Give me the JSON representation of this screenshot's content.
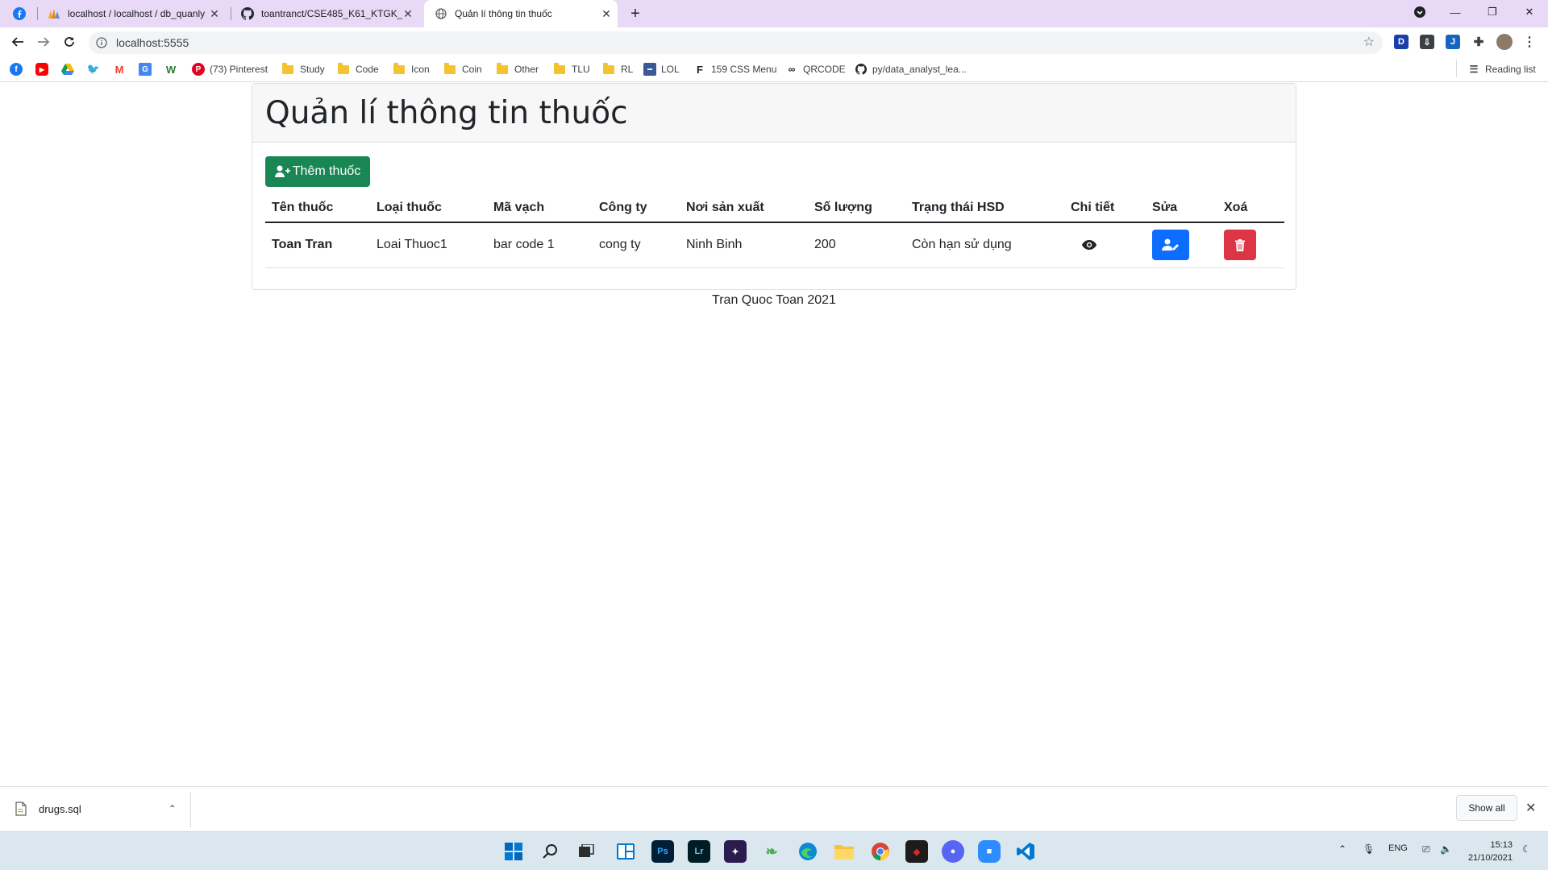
{
  "browser": {
    "tabs": [
      {
        "title": "localhost / localhost / db_quanly",
        "icon": "phpmyadmin-icon"
      },
      {
        "title": "toantranct/CSE485_K61_KTGK_19",
        "icon": "github-icon"
      },
      {
        "title": "Quản lí thông tin thuốc",
        "icon": "globe-icon"
      }
    ],
    "url": "localhost:5555",
    "bookmarks": [
      {
        "label": "(73) Pinterest"
      },
      {
        "label": "Study"
      },
      {
        "label": "Code"
      },
      {
        "label": "Icon"
      },
      {
        "label": "Coin"
      },
      {
        "label": "Other"
      },
      {
        "label": "TLU"
      },
      {
        "label": "RL"
      },
      {
        "label": "LOL"
      },
      {
        "label": "159 CSS Menu"
      },
      {
        "label": "QRCODE"
      },
      {
        "label": "py/data_analyst_lea..."
      }
    ],
    "reading_list": "Reading list"
  },
  "page": {
    "title": "Quản lí thông tin thuốc",
    "add_button": "Thêm thuốc",
    "table": {
      "headers": [
        "Tên thuốc",
        "Loại thuốc",
        "Mã vạch",
        "Công ty",
        "Nơi sản xuất",
        "Số lượng",
        "Trạng thái HSD",
        "Chi tiết",
        "Sửa",
        "Xoá"
      ],
      "rows": [
        {
          "name": "Toan Tran",
          "type": "Loai Thuoc1",
          "barcode": "bar code 1",
          "company": "cong ty",
          "origin": "Ninh Binh",
          "quantity": "200",
          "status": "Còn hạn sử dụng"
        }
      ]
    },
    "footer": "Tran Quoc Toan 2021"
  },
  "downloads": {
    "file": "drugs.sql",
    "show_all": "Show all"
  },
  "taskbar": {
    "language": "ENG",
    "time": "15:13",
    "date": "21/10/2021"
  },
  "colors": {
    "success": "#198754",
    "primary": "#0d6efd",
    "danger": "#dc3545"
  }
}
